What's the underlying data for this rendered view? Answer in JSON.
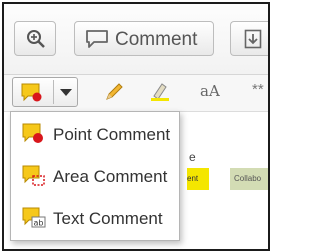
{
  "toolbar": {
    "comment_label": "Comment",
    "text_size_label": "aA",
    "overflow_glyph": "**"
  },
  "doc_fragments": {
    "yellow_tag_text": "ent",
    "green_tag_text": "Collabo",
    "partial_text": "e"
  },
  "menu": {
    "items": [
      {
        "label": "Point Comment",
        "icon": "point-comment-icon"
      },
      {
        "label": "Area Comment",
        "icon": "area-comment-icon"
      },
      {
        "label": "Text Comment",
        "icon": "text-comment-icon"
      }
    ]
  },
  "colors": {
    "note_yellow": "#f6c81a",
    "marker_red": "#d8161b",
    "highlight_yellow": "#f4e600",
    "tag_green": "#d3dcb4"
  }
}
